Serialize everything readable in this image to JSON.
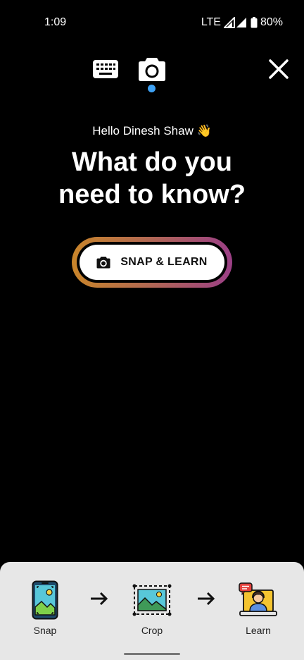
{
  "status_bar": {
    "time": "1:09",
    "network": "LTE",
    "battery": "80%"
  },
  "mode_switch": {
    "options": [
      "keyboard-icon",
      "camera-icon"
    ],
    "active": "camera",
    "indicator_color": "#3ea1f3"
  },
  "greeting": {
    "text": "Hello Dinesh Shaw 👋"
  },
  "headline": {
    "line1": "What do you",
    "line2": "need to know?"
  },
  "snap_button": {
    "label": "SNAP & LEARN",
    "gradient": [
      "#c9852a",
      "#9b3f86"
    ]
  },
  "steps": [
    {
      "label": "Snap",
      "icon": "phone-photo-icon"
    },
    {
      "label": "Crop",
      "icon": "crop-image-icon"
    },
    {
      "label": "Learn",
      "icon": "tutor-laptop-icon"
    }
  ],
  "colors": {
    "background": "#000000",
    "sheet": "#e7e7e7",
    "accent": "#3ea1f3"
  }
}
